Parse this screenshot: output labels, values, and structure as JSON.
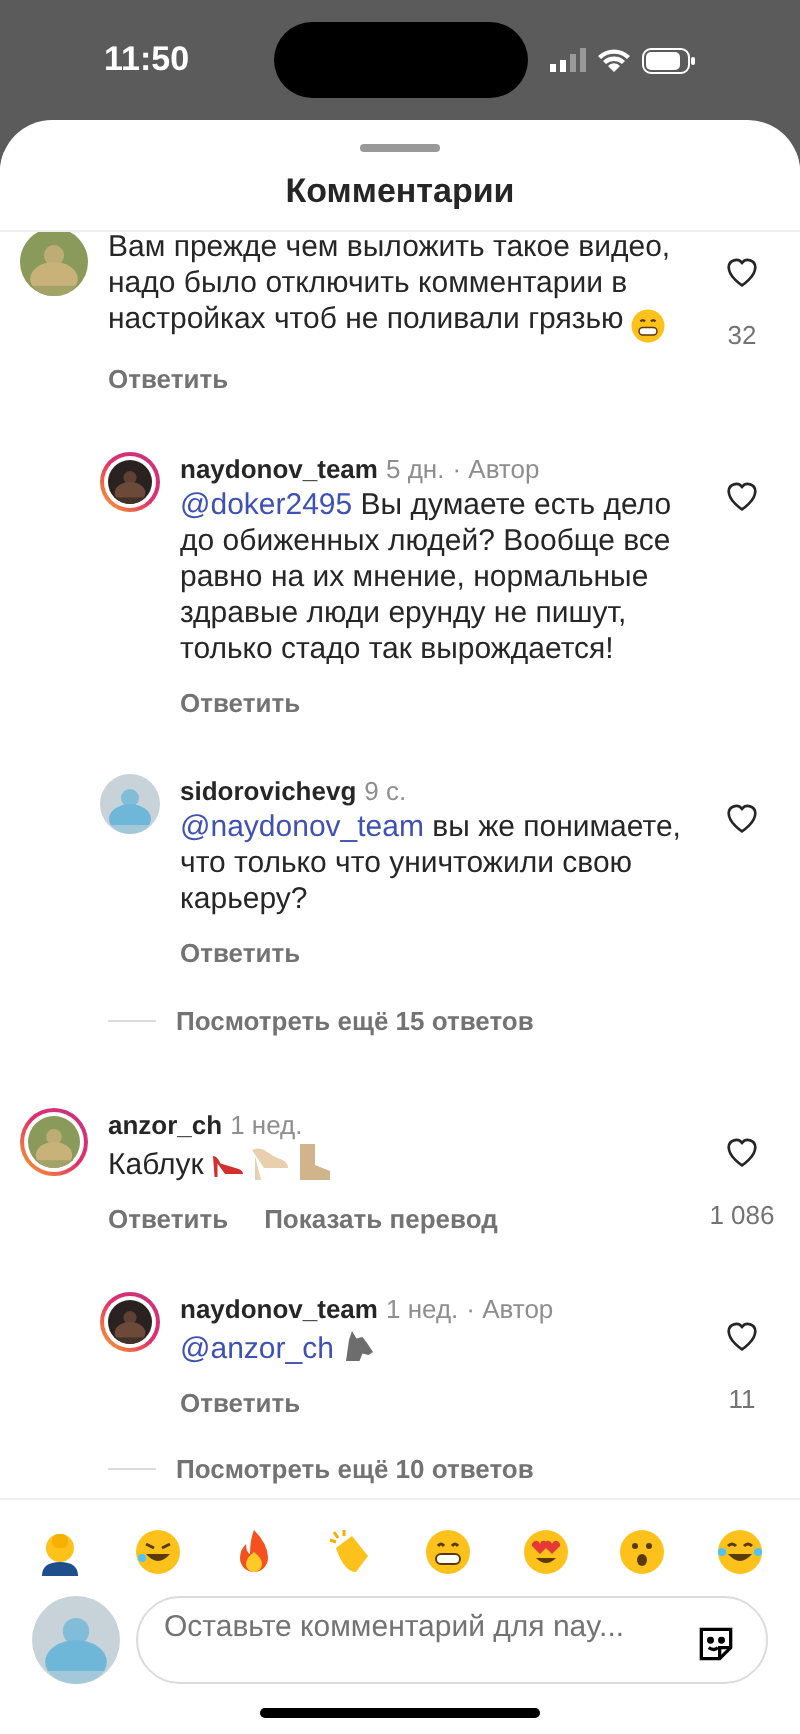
{
  "status_bar": {
    "time": "11:50"
  },
  "sheet": {
    "title": "Комментарии"
  },
  "comments": [
    {
      "kind": "top",
      "text": "Вам прежде чем выложить такое видео, надо было отключить комментарии в настройках чтоб не поливали грязью",
      "emojis": [
        {
          "kind": "grin"
        }
      ],
      "likes": "32",
      "actions": [
        "Ответить"
      ],
      "story_ring": false
    },
    {
      "kind": "reply",
      "username": "naydonov_team",
      "time": "5 дн.",
      "author": "· Автор",
      "mention": "@doker2495",
      "text": "Вы думаете есть дело до обиженных людей? Вообще все равно на их мнение, нормальные здравые люди ерунду не пишут, только стадо так вырождается!",
      "actions": [
        "Ответить"
      ],
      "story_ring": true
    },
    {
      "kind": "reply",
      "username": "sidorovichevg",
      "time": "9 с.",
      "mention": "@naydonov_team",
      "text": "вы же понимаете, что только что уничтожили свою карьеру?",
      "actions": [
        "Ответить"
      ],
      "story_ring": false
    },
    {
      "kind": "more",
      "text": "Посмотреть ещё 15 ответов"
    },
    {
      "kind": "top",
      "username": "anzor_ch",
      "time": "1 нед.",
      "text": "Каблук",
      "emojis": [
        {
          "kind": "heel"
        },
        {
          "kind": "sandal"
        },
        {
          "kind": "boot"
        }
      ],
      "likes": "1 086",
      "actions": [
        "Ответить",
        "Показать перевод"
      ],
      "story_ring": true
    },
    {
      "kind": "reply",
      "username": "naydonov_team",
      "time": "1 нед.",
      "author": "· Автор",
      "mention": "@anzor_ch",
      "emojis": [
        {
          "kind": "wolf"
        }
      ],
      "likes": "11",
      "actions": [
        "Ответить"
      ],
      "story_ring": true
    },
    {
      "kind": "more",
      "text": "Посмотреть ещё 10 ответов"
    }
  ],
  "reactions": [
    {
      "kind": "facepalm"
    },
    {
      "kind": "rofl"
    },
    {
      "kind": "fire"
    },
    {
      "kind": "clap"
    },
    {
      "kind": "grin"
    },
    {
      "kind": "hearteyes"
    },
    {
      "kind": "wow"
    },
    {
      "kind": "joy"
    }
  ],
  "composer": {
    "placeholder": "Оставьте комментарий для nay..."
  }
}
